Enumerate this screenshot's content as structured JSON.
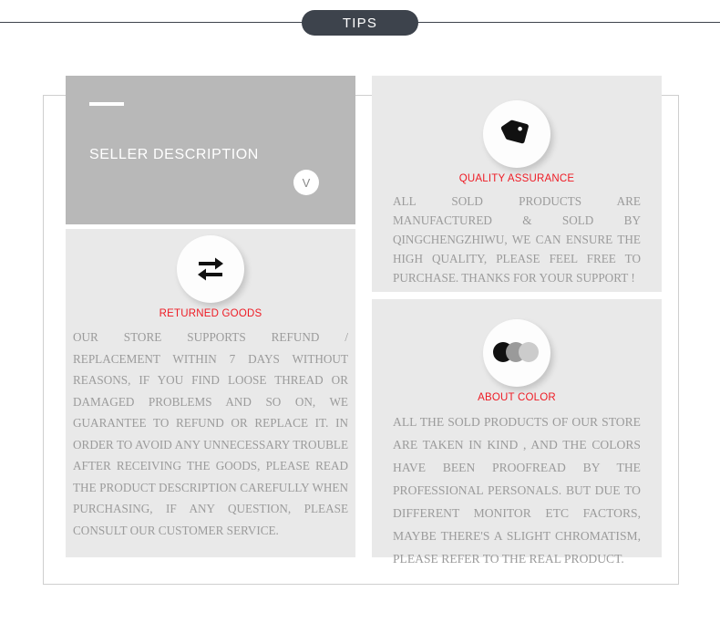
{
  "header": {
    "badge_label": "TIPS",
    "accent_dark": "#3d434c"
  },
  "hero": {
    "title": "SELLER DESCRIPTION",
    "toggle_label": "V",
    "background": "#b8b8b8"
  },
  "panels": {
    "quality": {
      "icon": "price-tag-icon",
      "title": "QUALITY ASSURANCE",
      "title_color": "#ee1b24",
      "text": "ALL SOLD PRODUCTS ARE MANUFACTURED & SOLD BY QINGCHENGZHIWU, WE CAN ENSURE THE HIGH QUALITY, PLEASE FEEL FREE TO PURCHASE. THANKS FOR YOUR SUPPORT !"
    },
    "returned": {
      "icon": "repeat-arrows-icon",
      "title": "RETURNED GOODS",
      "title_color": "#ee1b24",
      "text": "OUR STORE SUPPORTS REFUND / REPLACEMENT WITHIN 7 DAYS WITHOUT REASONS, IF YOU FIND LOOSE THREAD OR DAMAGED PROBLEMS AND SO ON, WE GUARANTEE TO REFUND OR REPLACE IT. IN ORDER TO AVOID ANY UNNECESSARY TROUBLE AFTER RECEIVING THE GOODS, PLEASE READ THE PRODUCT DESCRIPTION CAREFULLY WHEN PURCHASING, IF ANY QUESTION, PLEASE CONSULT OUR CUSTOMER SERVICE."
    },
    "color": {
      "icon": "color-swatches-icon",
      "title": "ABOUT COLOR",
      "title_color": "#ee1b24",
      "text": "ALL THE SOLD PRODUCTS OF OUR STORE ARE TAKEN IN KIND , AND THE COLORS HAVE BEEN PROOFREAD BY THE PROFESSIONAL PERSONALS. BUT DUE TO DIFFERENT MONITOR ETC FACTORS, MAYBE THERE'S A SLIGHT CHROMATISM, PLEASE REFER TO THE REAL PRODUCT.",
      "swatch_colors": [
        "#111111",
        "#9a9a9a",
        "#cccccc"
      ]
    }
  }
}
